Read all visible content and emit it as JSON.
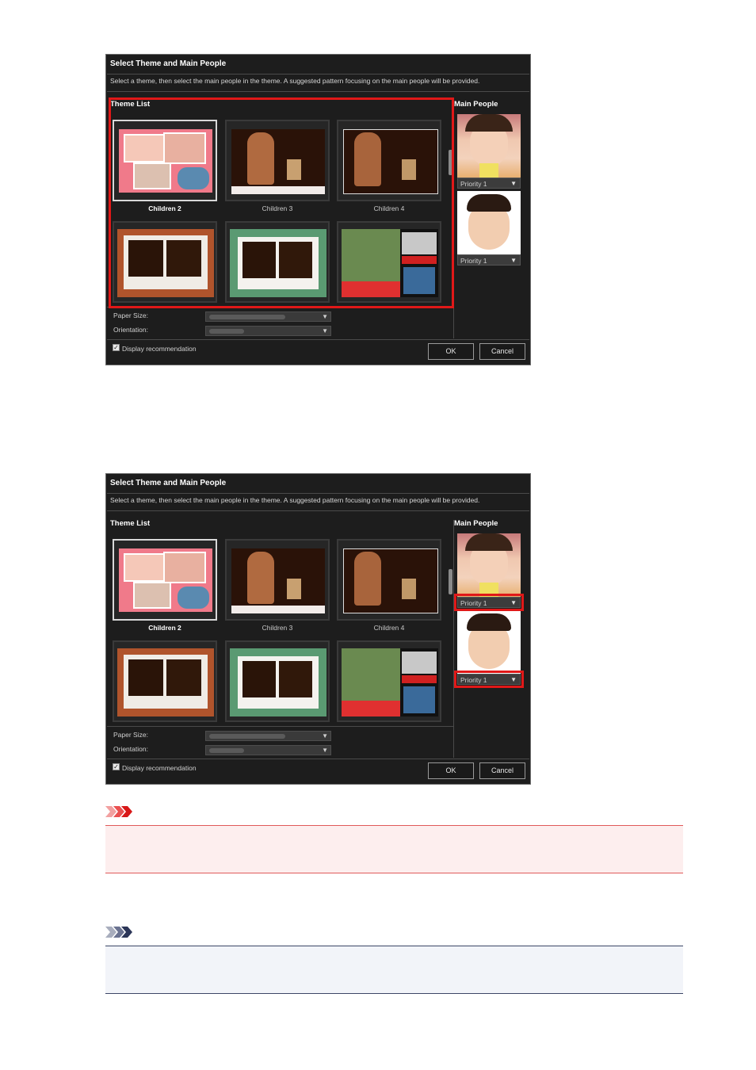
{
  "dialogs": [
    {
      "title": "Select Theme and Main People",
      "description": "Select a theme, then select the main people in the theme. A suggested pattern focusing on the main people will be provided.",
      "theme_list_label": "Theme List",
      "main_people_label": "Main People",
      "themes": [
        {
          "caption": "Children 2",
          "selected": true
        },
        {
          "caption": "Children 3",
          "selected": false
        },
        {
          "caption": "Children 4",
          "selected": false
        },
        {
          "caption": "",
          "selected": false
        },
        {
          "caption": "",
          "selected": false
        },
        {
          "caption": "",
          "selected": false
        }
      ],
      "people": [
        {
          "priority": "Priority 1"
        },
        {
          "priority": "Priority 1"
        }
      ],
      "paper_size_label": "Paper Size:",
      "orientation_label": "Orientation:",
      "display_recommendation_label": "Display recommendation",
      "display_recommendation_checked": true,
      "ok_label": "OK",
      "cancel_label": "Cancel",
      "highlight": "theme-list"
    },
    {
      "title": "Select Theme and Main People",
      "description": "Select a theme, then select the main people in the theme. A suggested pattern focusing on the main people will be provided.",
      "theme_list_label": "Theme List",
      "main_people_label": "Main People",
      "themes": [
        {
          "caption": "Children 2",
          "selected": true
        },
        {
          "caption": "Children 3",
          "selected": false
        },
        {
          "caption": "Children 4",
          "selected": false
        },
        {
          "caption": "",
          "selected": false
        },
        {
          "caption": "",
          "selected": false
        },
        {
          "caption": "",
          "selected": false
        }
      ],
      "people": [
        {
          "priority": "Priority 1"
        },
        {
          "priority": "Priority 1"
        }
      ],
      "paper_size_label": "Paper Size:",
      "orientation_label": "Orientation:",
      "display_recommendation_label": "Display recommendation",
      "display_recommendation_checked": true,
      "ok_label": "OK",
      "cancel_label": "Cancel",
      "highlight": "priority-dropdowns"
    }
  ],
  "colors": {
    "highlight": "#e01818",
    "important_band": "#fdeeee",
    "important_line": "#e05a5a",
    "note_band": "#f2f4f9",
    "note_line": "#3c4666"
  },
  "notices": {
    "important_icon": "important-chevrons-icon",
    "note_icon": "note-chevrons-icon"
  }
}
